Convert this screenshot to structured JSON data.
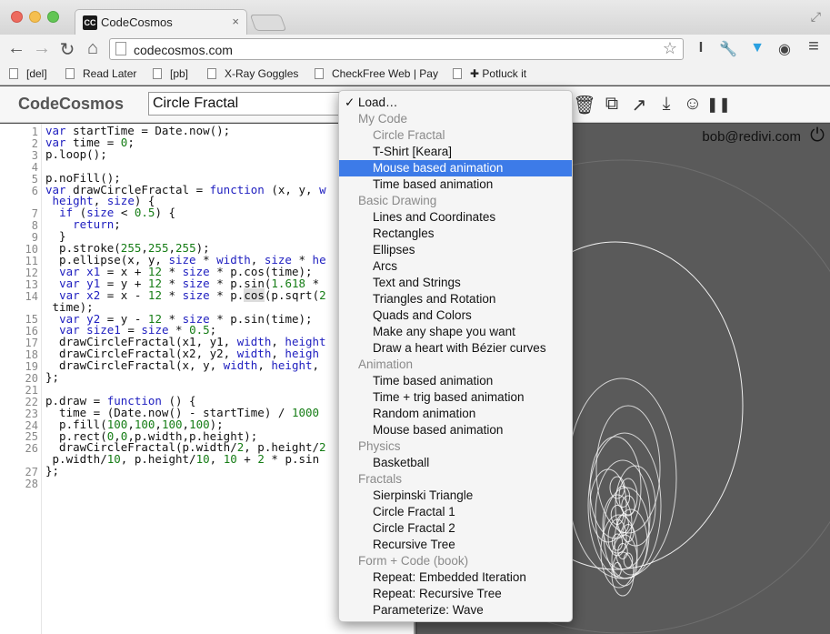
{
  "browser": {
    "tab_title": "CodeCosmos",
    "favicon_text": "CC",
    "tab_close": "×",
    "url": "codecosmos.com",
    "bookmarks": [
      "[del]",
      "Read Later",
      "[pb]",
      "X-Ray Goggles",
      "CheckFree Web | Pay",
      "✚ Potluck it"
    ]
  },
  "app": {
    "title": "CodeCosmos",
    "project_name": "Circle Fractal",
    "user": "bob@redivi.com"
  },
  "icons": {
    "back": "←",
    "forward": "→",
    "reload": "↻",
    "home": "⌂",
    "star": "☆",
    "trash": "🗑",
    "duplicate": "⧉",
    "share": "↗",
    "download": "⤓",
    "smiley": "☺",
    "pause": "❚❚",
    "power": "⏻",
    "fullscreen": "⤢",
    "wrench": "🔧",
    "menu": "≡"
  },
  "editor": {
    "line_numbers": [
      "1",
      "2",
      "3",
      "4",
      "5",
      "6",
      "",
      "7",
      "8",
      "9",
      "10",
      "11",
      "12",
      "13",
      "14",
      "",
      "15",
      "16",
      "17",
      "18",
      "19",
      "20",
      "21",
      "22",
      "23",
      "24",
      "25",
      "26",
      "",
      "27",
      "28"
    ]
  },
  "menu": {
    "check": "✓",
    "items": [
      {
        "label": "Load…",
        "kind": "top"
      },
      {
        "label": "My Code",
        "kind": "group"
      },
      {
        "label": "Circle Fractal",
        "kind": "grey"
      },
      {
        "label": "T-Shirt [Keara]",
        "kind": "item"
      },
      {
        "label": "Mouse based animation",
        "kind": "selected"
      },
      {
        "label": "Time based animation",
        "kind": "item"
      },
      {
        "label": "Basic Drawing",
        "kind": "group"
      },
      {
        "label": "Lines and Coordinates",
        "kind": "item"
      },
      {
        "label": "Rectangles",
        "kind": "item"
      },
      {
        "label": "Ellipses",
        "kind": "item"
      },
      {
        "label": "Arcs",
        "kind": "item"
      },
      {
        "label": "Text and Strings",
        "kind": "item"
      },
      {
        "label": "Triangles and Rotation",
        "kind": "item"
      },
      {
        "label": "Quads and Colors",
        "kind": "item"
      },
      {
        "label": "Make any shape you want",
        "kind": "item"
      },
      {
        "label": "Draw a heart with Bézier curves",
        "kind": "item"
      },
      {
        "label": "Animation",
        "kind": "group"
      },
      {
        "label": "Time based animation",
        "kind": "item"
      },
      {
        "label": "Time + trig based animation",
        "kind": "item"
      },
      {
        "label": "Random animation",
        "kind": "item"
      },
      {
        "label": "Mouse based animation",
        "kind": "item"
      },
      {
        "label": "Physics",
        "kind": "group"
      },
      {
        "label": "Basketball",
        "kind": "item"
      },
      {
        "label": "Fractals",
        "kind": "group"
      },
      {
        "label": "Sierpinski Triangle",
        "kind": "item"
      },
      {
        "label": "Circle Fractal 1",
        "kind": "item"
      },
      {
        "label": "Circle Fractal 2",
        "kind": "item"
      },
      {
        "label": "Recursive Tree",
        "kind": "item"
      },
      {
        "label": "Form + Code (book)",
        "kind": "group"
      },
      {
        "label": "Repeat: Embedded Iteration",
        "kind": "item"
      },
      {
        "label": "Repeat: Recursive Tree",
        "kind": "item"
      },
      {
        "label": "Parameterize: Wave",
        "kind": "item"
      }
    ]
  }
}
